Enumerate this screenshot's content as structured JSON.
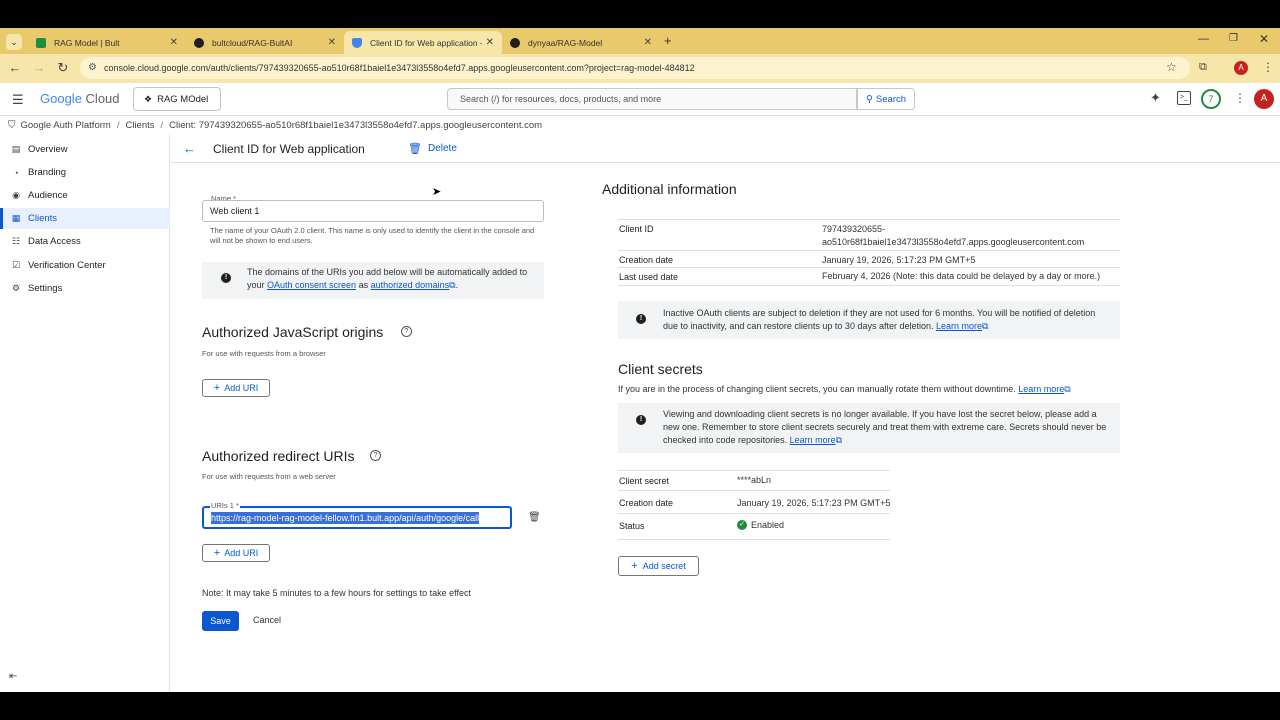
{
  "browser": {
    "tabs": [
      {
        "title": "RAG Model | Bult",
        "active": false,
        "favicon_color": "#1e8e3e"
      },
      {
        "title": "bultcloud/RAG-BultAI",
        "active": false,
        "favicon_color": "#1f1f1f"
      },
      {
        "title": "Client ID for Web application –",
        "active": true,
        "favicon_color": "#4285f4"
      },
      {
        "title": "dynyaa/RAG-Model",
        "active": false,
        "favicon_color": "#1f1f1f"
      }
    ],
    "url": "console.cloud.google.com/auth/clients/797439320655-ao510r68f1baiel1e3473l3558o4efd7.apps.googleusercontent.com?project=rag-model-484812",
    "profile_initial": "A"
  },
  "header": {
    "logo_google": "Google",
    "logo_cloud": "Cloud",
    "project": "RAG MOdel",
    "search_placeholder": "Search (/) for resources, docs, products, and more",
    "search_button": "Search",
    "notification_count": "7",
    "avatar_initial": "A"
  },
  "breadcrumb": {
    "items": [
      "Google Auth Platform",
      "Clients",
      "Client: 797439320655-ao510r68f1baiel1e3473l3558o4efd7.apps.googleusercontent.com"
    ]
  },
  "sidebar": {
    "items": [
      {
        "label": "Overview",
        "icon": "overview-icon"
      },
      {
        "label": "Branding",
        "icon": "branding-icon"
      },
      {
        "label": "Audience",
        "icon": "audience-icon"
      },
      {
        "label": "Clients",
        "icon": "clients-icon",
        "active": true
      },
      {
        "label": "Data Access",
        "icon": "data-access-icon"
      },
      {
        "label": "Verification Center",
        "icon": "verification-icon"
      },
      {
        "label": "Settings",
        "icon": "settings-icon"
      }
    ]
  },
  "page": {
    "title": "Client ID for Web application",
    "delete_label": "Delete"
  },
  "form": {
    "name_label": "Name *",
    "name_value": "Web client 1",
    "name_help": "The name of your OAuth 2.0 client. This name is only used to identify the client in the console and will not be shown to end users.",
    "domains_info_1": "The domains of the URIs you add below will be automatically added to your ",
    "domains_info_link1": "OAuth consent screen",
    "domains_info_2": " as ",
    "domains_info_link2": "authorized domains",
    "js_origins_title": "Authorized JavaScript origins",
    "js_origins_sub": "For use with requests from a browser",
    "add_uri_label": "Add URI",
    "redirect_title": "Authorized redirect URIs",
    "redirect_sub": "For use with requests from a web server",
    "uri1_label": "URIs 1 *",
    "uri1_value": "https://rag-model-rag-model-fellow.fin1.bult.app/api/auth/google/call",
    "note": "Note: It may take 5 minutes to a few hours for settings to take effect",
    "save_label": "Save",
    "cancel_label": "Cancel"
  },
  "additional": {
    "title": "Additional information",
    "rows": [
      {
        "label": "Client ID",
        "value": "797439320655-",
        "value2": "ao510r68f1baiel1e3473l3558o4efd7.apps.googleusercontent.com"
      },
      {
        "label": "Creation date",
        "value": "January 19, 2026, 5:17:23 PM GMT+5"
      },
      {
        "label": "Last used date",
        "value": "February 4, 2026 (Note: this data could be delayed by a day or more.)"
      }
    ],
    "inactive_info": "Inactive OAuth clients are subject to deletion if they are not used for 6 months. You will be notified of deletion due to inactivity, and can restore clients up to 30 days after deletion.",
    "learn_more": "Learn more"
  },
  "secrets": {
    "title": "Client secrets",
    "desc": "If you are in the process of changing client secrets, you can manually rotate them without downtime.",
    "learn_more": "Learn more",
    "warning": "Viewing and downloading client secrets is no longer available. If you have lost the secret below, please add a new one. Remember to store client secrets securely and treat them with extreme care. Secrets should never be checked into code repositories.",
    "warning_learn_more": "Learn more",
    "rows": [
      {
        "label": "Client secret",
        "value": "****abLn"
      },
      {
        "label": "Creation date",
        "value": "January 19, 2026, 5:17:23 PM GMT+5"
      },
      {
        "label": "Status",
        "value": "Enabled"
      }
    ],
    "add_secret": "Add secret"
  }
}
